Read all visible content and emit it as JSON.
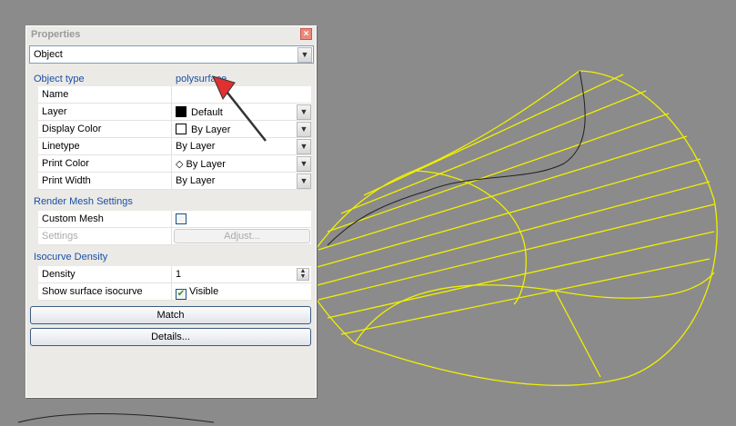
{
  "panel": {
    "title": "Properties",
    "close": "×",
    "selector": "Object"
  },
  "object_type": {
    "label": "Object type",
    "value": "polysurface"
  },
  "properties": [
    {
      "label": "Name",
      "value": ""
    },
    {
      "label": "Layer",
      "value": "Default"
    },
    {
      "label": "Display Color",
      "value": "By Layer"
    },
    {
      "label": "Linetype",
      "value": "By Layer"
    },
    {
      "label": "Print Color",
      "value": "◇ By Layer"
    },
    {
      "label": "Print Width",
      "value": "By Layer"
    }
  ],
  "render_mesh": {
    "header": "Render Mesh Settings",
    "custom_mesh": "Custom Mesh",
    "settings": "Settings",
    "adjust": "Adjust..."
  },
  "isocurve": {
    "header": "Isocurve Density",
    "density_label": "Density",
    "density": "1",
    "show_label": "Show surface isocurve",
    "show_value": "Visible"
  },
  "buttons": {
    "match": "Match",
    "details": "Details..."
  },
  "colors": {
    "viewport": "#8b8b8b",
    "curve": "#ffff00",
    "header": "#1a4fa6",
    "arrow": "#e03030"
  }
}
